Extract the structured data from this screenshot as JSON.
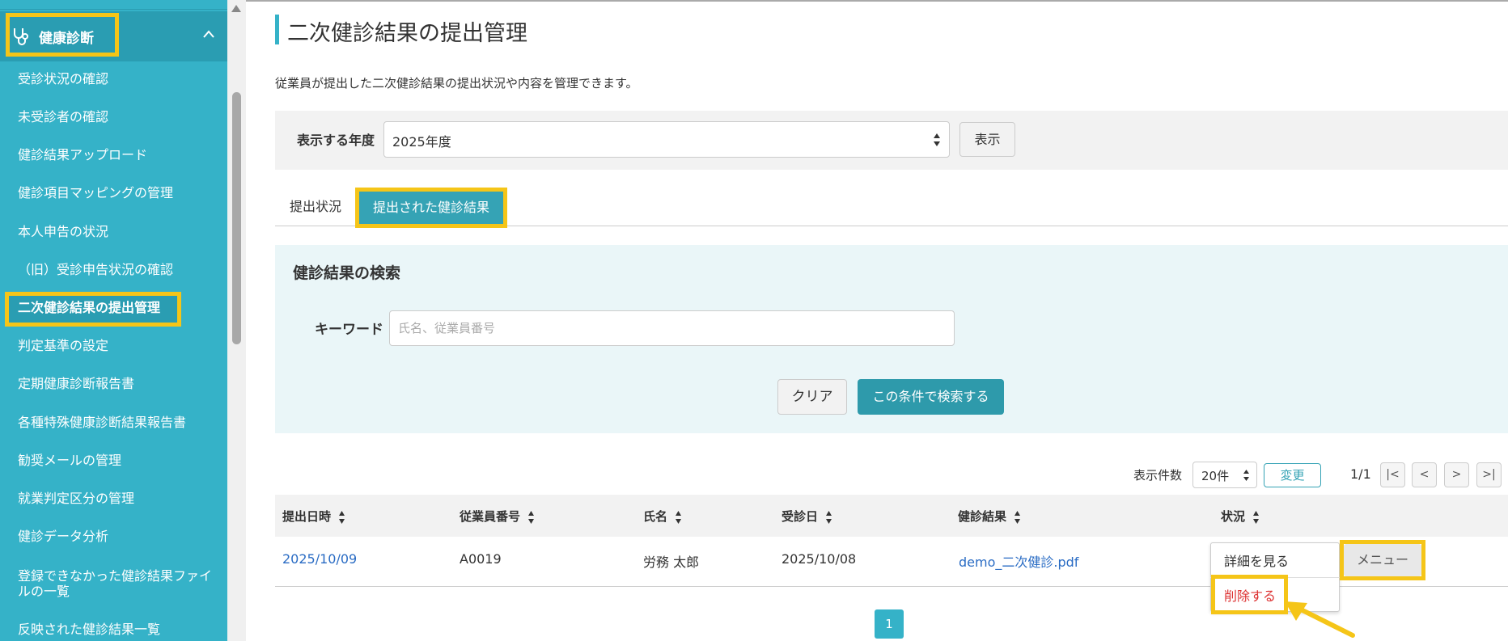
{
  "sidebar": {
    "header_label": "健康診断",
    "items": [
      {
        "label": "受診状況の確認"
      },
      {
        "label": "未受診者の確認"
      },
      {
        "label": "健診結果アップロード"
      },
      {
        "label": "健診項目マッピングの管理"
      },
      {
        "label": "本人申告の状況"
      },
      {
        "label": "（旧）受診申告状況の確認"
      },
      {
        "label": "二次健診結果の提出管理",
        "active": true
      },
      {
        "label": "判定基準の設定"
      },
      {
        "label": "定期健康診断報告書"
      },
      {
        "label": "各種特殊健康診断結果報告書"
      },
      {
        "label": "勧奨メールの管理"
      },
      {
        "label": "就業判定区分の管理"
      },
      {
        "label": "健診データ分析"
      },
      {
        "label": "登録できなかった健診結果ファイルの一覧"
      },
      {
        "label": "反映された健診結果一覧"
      }
    ]
  },
  "page": {
    "title": "二次健診結果の提出管理",
    "description": "従業員が提出した二次健診結果の提出状況や内容を管理できます。"
  },
  "year_filter": {
    "label": "表示する年度",
    "selected": "2025年度",
    "button": "表示"
  },
  "tabs": [
    {
      "label": "提出状況"
    },
    {
      "label": "提出された健診結果",
      "active": true
    }
  ],
  "search": {
    "title": "健診結果の検索",
    "keyword_label": "キーワード",
    "keyword_placeholder": "氏名、従業員番号",
    "keyword_value": "",
    "clear_button": "クリア",
    "search_button": "この条件で検索する"
  },
  "pagination": {
    "per_page_label": "表示件数",
    "per_page_value": "20件",
    "change_button": "変更",
    "page_indicator": "1/1",
    "first": "|<",
    "prev": "<",
    "next": ">",
    "last": ">|",
    "current_page": "1"
  },
  "table": {
    "columns": [
      "提出日時",
      "従業員番号",
      "氏名",
      "受診日",
      "健診結果",
      "状況"
    ],
    "rows": [
      {
        "submitted_at": "2025/10/09",
        "employee_no": "A0019",
        "name": "労務 太郎",
        "exam_date": "2025/10/08",
        "result_file": "demo_二次健診.pdf",
        "status": ""
      }
    ]
  },
  "row_menu": {
    "button": "メニュー",
    "items": [
      "詳細を見る",
      "削除する"
    ]
  },
  "colors": {
    "sidebar": "#35b2c8",
    "accent": "#35a3b5",
    "highlight": "#f5c518",
    "danger": "#dd3333",
    "link": "#2a6cc4"
  }
}
